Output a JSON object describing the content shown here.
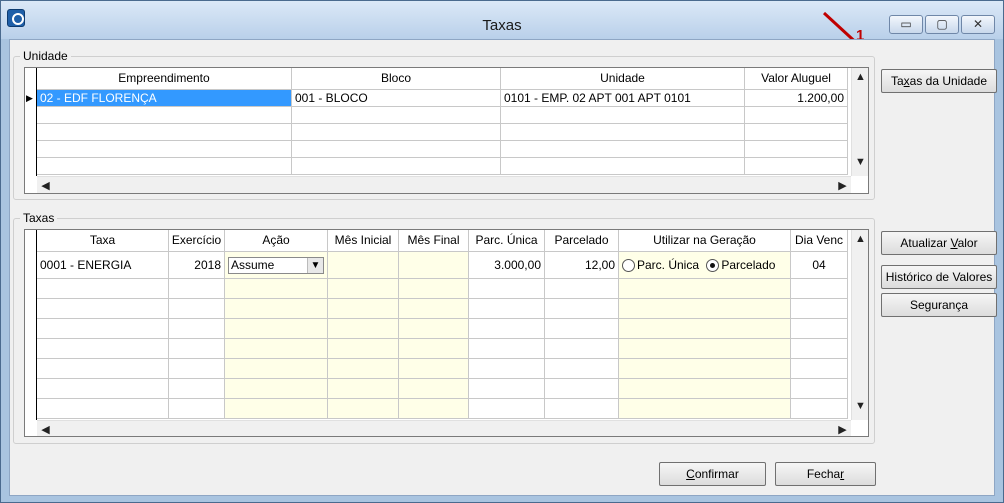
{
  "window": {
    "title": "Taxas",
    "minimize_glyph": "▭",
    "maximize_glyph": "▢",
    "close_glyph": "✕"
  },
  "annotation": {
    "label": "1",
    "arrow_color": "#c00000"
  },
  "unidade": {
    "legend": "Unidade",
    "columns": [
      "Empreendimento",
      "Bloco",
      "Unidade",
      "Valor Aluguel"
    ],
    "rows": [
      {
        "empreendimento": "02 - EDF FLORENÇA",
        "bloco": "001 - BLOCO",
        "unidade": "0101 - EMP. 02 APT 001 APT 0101",
        "valor_aluguel": "1.200,00"
      }
    ]
  },
  "taxas": {
    "legend": "Taxas",
    "columns": [
      "Taxa",
      "Exercício",
      "Ação",
      "Mês Inicial",
      "Mês Final",
      "Parc. Única",
      "Parcelado",
      "Utilizar na Geração",
      "Dia Venc"
    ],
    "rows": [
      {
        "taxa": "0001 - ENERGIA",
        "exercicio": "2018",
        "acao": "Assume",
        "mes_inicial": "",
        "mes_final": "",
        "parc_unica": "3.000,00",
        "parcelado": "12,00",
        "geracao_opcao_1": "Parc. Única",
        "geracao_opcao_2": "Parcelado",
        "geracao_selected": "Parcelado",
        "dia_venc": "04"
      }
    ]
  },
  "buttons": {
    "taxas_unidade": {
      "pre": "Ta",
      "key": "x",
      "post": "as da Unidade"
    },
    "atualizar_valor": {
      "pre": "Atualizar ",
      "key": "V",
      "post": "alor"
    },
    "historico_valores": {
      "pre": "",
      "key": "",
      "post": "Histórico de Valores"
    },
    "seguranca": {
      "pre": "",
      "key": "",
      "post": "Segurança"
    },
    "confirmar": {
      "pre": "",
      "key": "C",
      "post": "onfirmar"
    },
    "fechar": {
      "pre": "Fecha",
      "key": "r",
      "post": ""
    }
  },
  "icons": {
    "scroll_up": "▲",
    "scroll_down": "▼",
    "scroll_left": "◀",
    "scroll_right": "▶",
    "row_pointer": "▶",
    "combo_arrow": "▼"
  },
  "colors": {
    "selection": "#3399ff",
    "editable_cell": "#ffffe8",
    "window_frame": "#a9c4e0"
  }
}
